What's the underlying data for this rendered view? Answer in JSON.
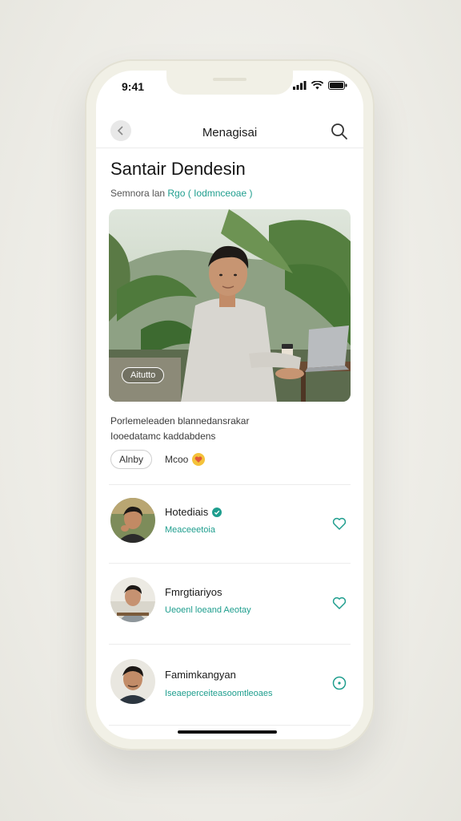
{
  "status": {
    "time": "9:41"
  },
  "nav": {
    "title": "Menagisai"
  },
  "profile": {
    "name": "Santair Dendesin",
    "subtitle_prefix": "Semnora lan",
    "subtitle_tag": "Rgo",
    "subtitle_link": "( Iodmnceoae )"
  },
  "hero": {
    "tag_label": "Aitutto"
  },
  "description": {
    "line1": "Porlemeleaden blannedansrakar",
    "line2": "Iooedatamc kaddabdens"
  },
  "actions": {
    "chip_label": "Alnby",
    "reaction_label": "Mcoo"
  },
  "people": [
    {
      "name": "Hotediais",
      "verified": true,
      "subtitle": "Meaceeetoia",
      "action_icon": "heart-outline-icon"
    },
    {
      "name": "Fmrgtiariyos",
      "verified": false,
      "subtitle": "Ueoenl loeand Aeotay",
      "action_icon": "heart-outline-icon"
    },
    {
      "name": "Famimkangyan",
      "verified": false,
      "subtitle": "Iseaeperceiteasoomtleoaes",
      "action_icon": "info-circle-icon"
    }
  ],
  "colors": {
    "accent": "#1f9e8e",
    "background": "#ffffff",
    "phone_frame": "#f1f0e6"
  }
}
